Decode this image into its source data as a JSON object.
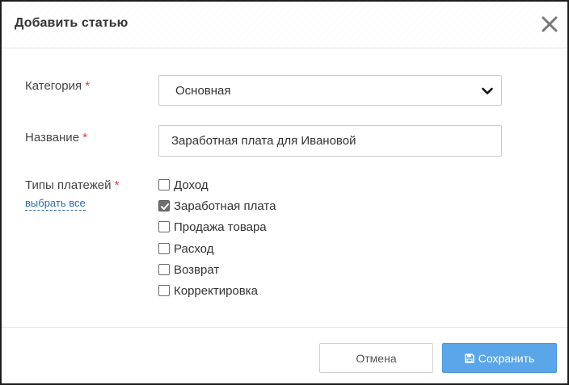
{
  "modal": {
    "title": "Добавить статью",
    "close_icon": "close-icon"
  },
  "form": {
    "category": {
      "label": "Категория",
      "required_mark": "*",
      "selected_value": "Основная",
      "icon": "chevron-down-icon"
    },
    "name": {
      "label": "Название",
      "required_mark": "*",
      "value": "Заработная плата для Ивановой"
    },
    "payment_types": {
      "label": "Типы платежей",
      "required_mark": "*",
      "select_all_link": "выбрать все",
      "options": [
        {
          "label": "Доход",
          "checked": false
        },
        {
          "label": "Заработная плата",
          "checked": true
        },
        {
          "label": "Продажа товара",
          "checked": false
        },
        {
          "label": "Расход",
          "checked": false
        },
        {
          "label": "Возврат",
          "checked": false
        },
        {
          "label": "Корректировка",
          "checked": false
        }
      ]
    }
  },
  "footer": {
    "cancel_label": "Отмена",
    "save_label": "Сохранить",
    "save_icon": "floppy-disk-icon"
  },
  "colors": {
    "required": "#e53935",
    "link": "#2a6bb0",
    "primary_button": "#5aa6e8"
  }
}
